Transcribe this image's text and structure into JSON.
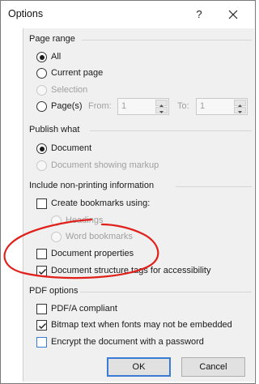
{
  "dialog": {
    "title": "Options",
    "help_glyph": "?"
  },
  "page_range": {
    "label": "Page range",
    "all": "All",
    "current_page": "Current page",
    "selection": "Selection",
    "pages": "Page(s)",
    "from_label": "From:",
    "from_value": "1",
    "to_label": "To:",
    "to_value": "1",
    "selected": "All"
  },
  "publish_what": {
    "label": "Publish what",
    "document": "Document",
    "document_markup": "Document showing markup",
    "selected": "Document"
  },
  "non_printing": {
    "label": "Include non-printing information",
    "create_bookmarks": "Create bookmarks using:",
    "headings": "Headings",
    "word_bookmarks": "Word bookmarks",
    "document_properties": "Document properties",
    "structure_tags": "Document structure tags for accessibility",
    "create_bookmarks_checked": false,
    "document_properties_checked": false,
    "structure_tags_checked": true
  },
  "pdf_options": {
    "label": "PDF options",
    "pdfa": "PDF/A compliant",
    "bitmap_text": "Bitmap text when fonts may not be embedded",
    "encrypt": "Encrypt the document with a password",
    "pdfa_checked": false,
    "bitmap_text_checked": true,
    "encrypt_checked": false
  },
  "buttons": {
    "ok": "OK",
    "cancel": "Cancel"
  },
  "colors": {
    "accent": "#3a7bd5",
    "annotation": "#e0201a"
  }
}
